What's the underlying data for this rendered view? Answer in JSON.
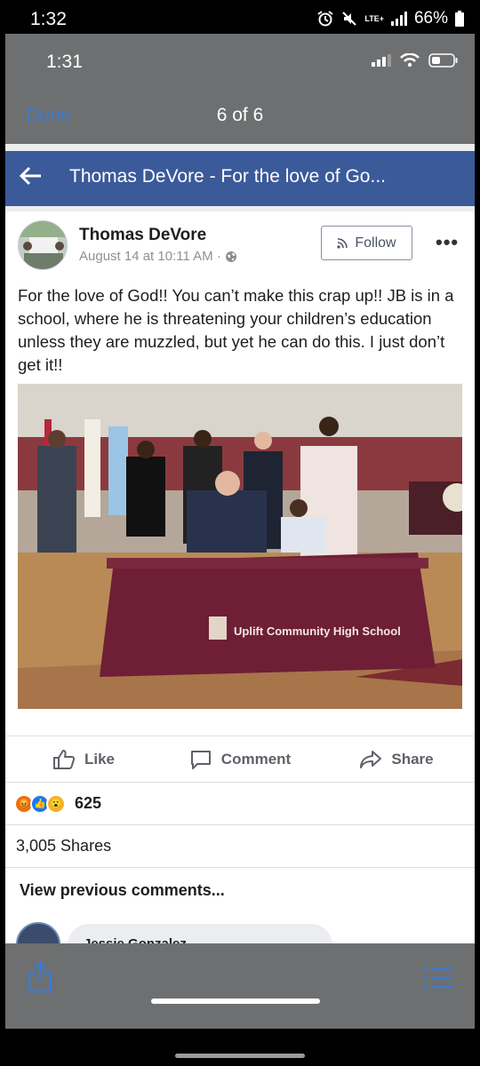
{
  "device_status": {
    "time": "1:32",
    "network": "LTE+",
    "battery": "66%"
  },
  "ios_status": {
    "time": "1:31"
  },
  "viewer": {
    "done_label": "Done",
    "counter": "6 of 6"
  },
  "fb_header": {
    "title": "Thomas DeVore - For the love of Go..."
  },
  "post": {
    "author": "Thomas DeVore",
    "timestamp": "August 14 at 10:11 AM ·",
    "follow_label": "Follow",
    "text": "For the love of God!! You can’t make this crap up!! JB is in a school, where he is threatening your children’s education unless they are muzzled, but yet he can do this. I just don’t get it!!",
    "photo_sign": "Uplift Community High School",
    "actions": {
      "like": "Like",
      "comment": "Comment",
      "share": "Share"
    },
    "reaction_count": "625",
    "shares": "3,005 Shares",
    "view_previous": "View previous comments...",
    "comment_author": "Jessie Gonzalez"
  },
  "colors": {
    "fb_blue": "#3b5a9a",
    "ios_link": "#3a7bd5",
    "ios_bar": "#6e6f70"
  }
}
